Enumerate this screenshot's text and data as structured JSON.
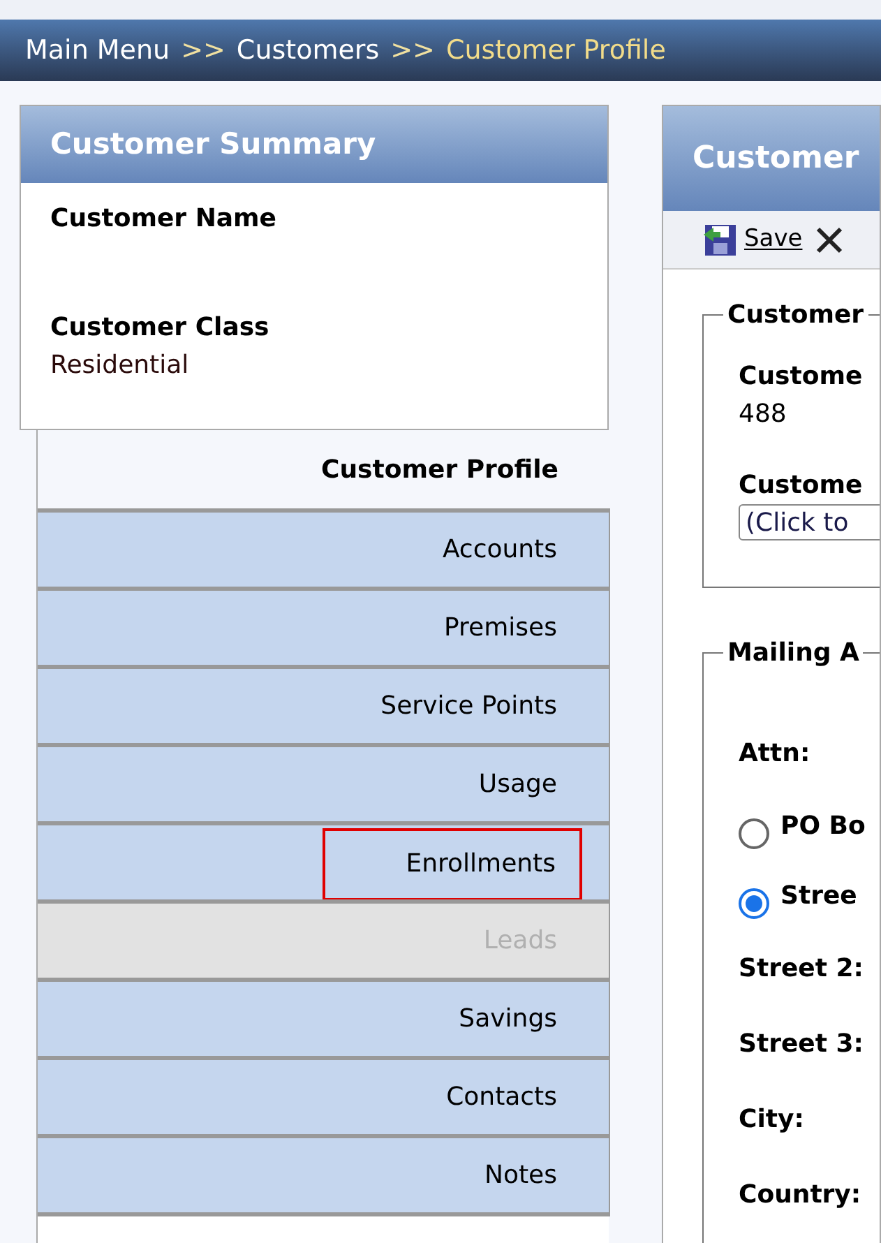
{
  "breadcrumb": [
    {
      "label": "Main Menu",
      "current": false
    },
    {
      "label": ">>",
      "kind": "separator"
    },
    {
      "label": "Customers",
      "current": false
    },
    {
      "label": ">>",
      "kind": "separator"
    },
    {
      "label": "Customer Profile",
      "current": true
    }
  ],
  "summary": {
    "title": "Customer Summary",
    "fields": [
      {
        "label": "Customer Name"
      },
      {
        "label": "Customer Class",
        "value": "Residential"
      }
    ]
  },
  "nav": [
    {
      "label": "Customer Profile",
      "selected": true,
      "disabled": false,
      "highlighted": false
    },
    {
      "label": "Accounts",
      "selected": false,
      "disabled": false,
      "highlighted": false
    },
    {
      "label": "Premises",
      "selected": false,
      "disabled": false,
      "highlighted": false
    },
    {
      "label": "Service Points",
      "selected": false,
      "disabled": false,
      "highlighted": false
    },
    {
      "label": "Usage",
      "selected": false,
      "disabled": false,
      "highlighted": false
    },
    {
      "label": "Enrollments",
      "selected": false,
      "disabled": false,
      "highlighted": true
    },
    {
      "label": "Leads",
      "selected": false,
      "disabled": true,
      "highlighted": false
    },
    {
      "label": "Savings",
      "selected": false,
      "disabled": false,
      "highlighted": false
    },
    {
      "label": "Contacts",
      "selected": false,
      "disabled": false,
      "highlighted": false
    },
    {
      "label": "Notes",
      "selected": false,
      "disabled": false,
      "highlighted": false
    }
  ],
  "detail": {
    "title": "Customer",
    "toolbar": [
      {
        "kind": "save",
        "label": "Save"
      },
      {
        "kind": "cancel"
      }
    ],
    "customer_group": {
      "legend": "Customer",
      "fields": [
        {
          "kind": "text",
          "label": "Custome",
          "value": "488"
        },
        {
          "kind": "select",
          "label": "Custome",
          "value": "(Click to"
        }
      ]
    },
    "mailing_group": {
      "legend": "Mailing A",
      "fields": [
        {
          "kind": "label",
          "label": "Attn:"
        },
        {
          "kind": "radio",
          "label": "PO Bo",
          "checked": false
        },
        {
          "kind": "radio",
          "label": "Stree",
          "checked": true
        },
        {
          "kind": "label",
          "label": "Street 2:"
        },
        {
          "kind": "label",
          "label": "Street 3:"
        },
        {
          "kind": "label",
          "label": "City:"
        },
        {
          "kind": "label",
          "label": "Country:"
        }
      ]
    }
  }
}
